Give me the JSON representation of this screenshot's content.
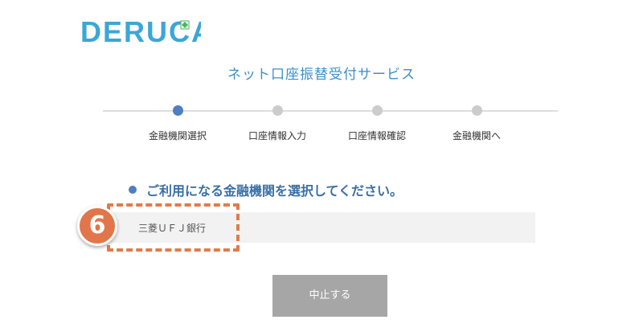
{
  "brand": {
    "logo_text": "DERUCA",
    "logo_color": "#3ba7d6",
    "cross_color": "#44b35a"
  },
  "header": {
    "service_title": "ネット口座振替受付サービス"
  },
  "steps": [
    {
      "label": "金融機関選択",
      "active": true
    },
    {
      "label": "口座情報入力",
      "active": false
    },
    {
      "label": "口座情報確認",
      "active": false
    },
    {
      "label": "金融機関へ",
      "active": false
    }
  ],
  "main": {
    "instruction": "ご利用になる金融機関を選択してください。",
    "banks": [
      {
        "name": "三菱ＵＦＪ銀行"
      }
    ],
    "cancel_label": "中止する"
  },
  "annotation": {
    "badge_number": "6",
    "color": "#e0764a"
  }
}
